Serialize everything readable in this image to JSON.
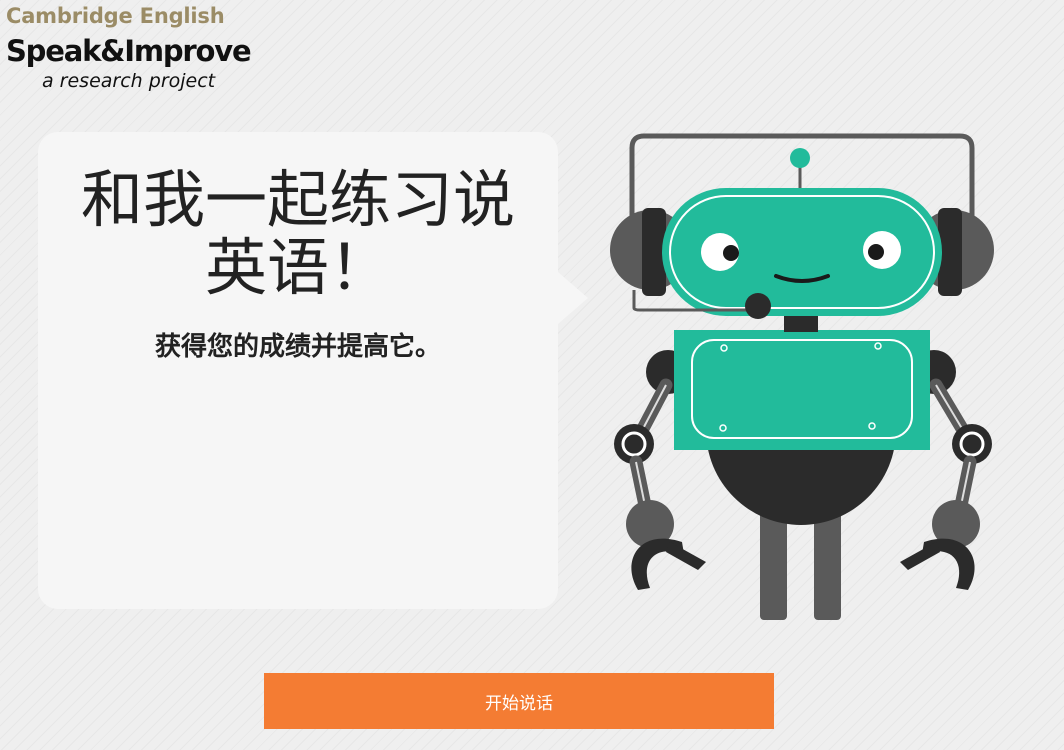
{
  "logo": {
    "brand": "Cambridge English",
    "product": "Speak&Improve",
    "tagline": "a research project"
  },
  "bubble": {
    "headline_line1": "和我一起练习说",
    "headline_line2": "英语！",
    "subheadline": "获得您的成绩并提高它。"
  },
  "robot": {
    "icon": "robot-with-headset",
    "colors": {
      "body_teal": "#22bb9b",
      "dark": "#2b2b2b",
      "gray": "#5a5a5a",
      "light_gray": "#888888"
    }
  },
  "start_button": {
    "label": "开始说话",
    "color": "#f47c33"
  },
  "colors": {
    "background": "#efefef",
    "bubble": "#f6f6f6",
    "brand": "#9b8c66"
  }
}
